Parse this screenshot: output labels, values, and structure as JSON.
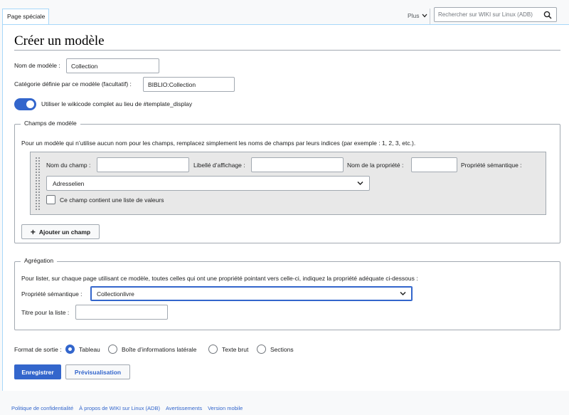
{
  "header": {
    "tab_label": "Page spéciale",
    "more_label": "Plus",
    "search_placeholder": "Rechercher sur WIKI sur Linux (ADB)"
  },
  "page": {
    "title": "Créer un modèle"
  },
  "form": {
    "template_name_label": "Nom de modèle :",
    "template_name_value": "Collection",
    "category_label": "Catégorie définie par ce modèle (facultatif) :",
    "category_value": "BIBLIO:Collection",
    "toggle_label": "Utiliser le wikicode complet au lieu de #template_display",
    "toggle_on": true
  },
  "fields_section": {
    "legend": "Champs de modèle",
    "description": "Pour un modèle qui n’utilise aucun nom pour les champs, remplacez simplement les noms de champs par leurs indices (par exemple : 1, 2, 3, etc.).",
    "field": {
      "name_label": "Nom du champ :",
      "name_value": "",
      "display_label": "Libellé d’affichage :",
      "display_value": "",
      "property_name_label": "Nom de la propriété :",
      "property_name_value": "",
      "semantic_property_label": "Propriété sémantique :",
      "semantic_property_selected": "Adresselien",
      "list_checkbox_label": "Ce champ contient une liste de valeurs",
      "list_checked": false
    },
    "add_button_label": "Ajouter un champ"
  },
  "aggregation_section": {
    "legend": "Agrégation",
    "description": "Pour lister, sur chaque page utilisant ce modèle, toutes celles qui ont une propriété pointant vers celle-ci, indiquez la propriété adéquate ci-dessous :",
    "property_label": "Propriété sémantique :",
    "property_selected": "Collectionlivre",
    "list_title_label": "Titre pour la liste :",
    "list_title_value": ""
  },
  "output_format": {
    "label": "Format de sortie :",
    "options": [
      "Tableau",
      "Boîte d’informations latérale",
      "Texte brut",
      "Sections"
    ],
    "selected": "Tableau"
  },
  "actions": {
    "save_label": "Enregistrer",
    "preview_label": "Prévisualisation"
  },
  "footer": {
    "links": [
      "Politique de confidentialité",
      "À propos de WIKI sur Linux (ADB)",
      "Avertissements",
      "Version mobile"
    ]
  },
  "colors": {
    "accent": "#3366cc",
    "border": "#a2a9b1",
    "field_row_bg": "#e8e8e8"
  }
}
